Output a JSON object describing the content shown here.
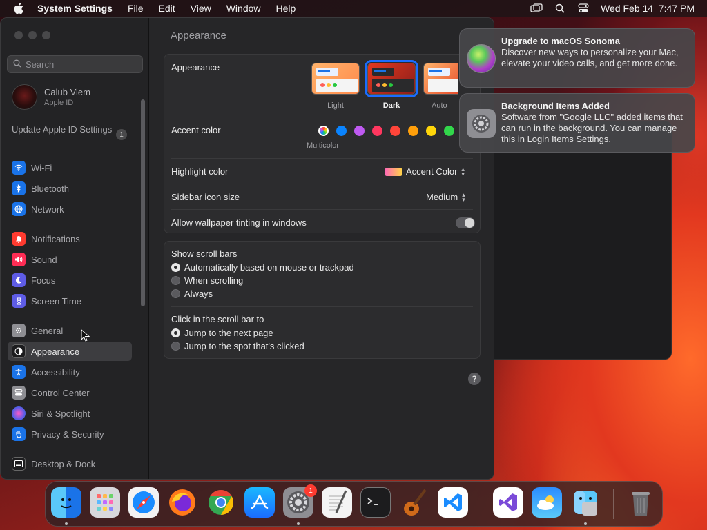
{
  "menubar": {
    "app_name": "System Settings",
    "items": [
      "File",
      "Edit",
      "View",
      "Window",
      "Help"
    ],
    "clock": "Wed Feb 14  7:47 PM"
  },
  "sidebar": {
    "search_placeholder": "Search",
    "profile": {
      "name": "Calub Viem",
      "subtitle": "Apple ID"
    },
    "update": {
      "label": "Update Apple ID Settings",
      "badge": "1"
    },
    "items": [
      {
        "label": "Wi-Fi",
        "icon": "wifi-icon",
        "color": "#1a73e8"
      },
      {
        "label": "Bluetooth",
        "icon": "bluetooth-icon",
        "color": "#1a73e8"
      },
      {
        "label": "Network",
        "icon": "globe-icon",
        "color": "#1a73e8"
      },
      {
        "label": "Notifications",
        "icon": "bell-icon",
        "color": "#ff3b30"
      },
      {
        "label": "Sound",
        "icon": "speaker-icon",
        "color": "#ff2d55"
      },
      {
        "label": "Focus",
        "icon": "moon-icon",
        "color": "#5e5ce6"
      },
      {
        "label": "Screen Time",
        "icon": "hourglass-icon",
        "color": "#5e5ce6"
      },
      {
        "label": "General",
        "icon": "gear-icon",
        "color": "#8e8e93"
      },
      {
        "label": "Appearance",
        "icon": "appearance-icon",
        "color": "#1c1c1e"
      },
      {
        "label": "Accessibility",
        "icon": "accessibility-icon",
        "color": "#1a73e8"
      },
      {
        "label": "Control Center",
        "icon": "control-center-icon",
        "color": "#8e8e93"
      },
      {
        "label": "Siri & Spotlight",
        "icon": "siri-icon",
        "color": "#bf5af2"
      },
      {
        "label": "Privacy & Security",
        "icon": "hand-icon",
        "color": "#1a73e8"
      },
      {
        "label": "Desktop & Dock",
        "icon": "dock-icon",
        "color": "#1c1c1e"
      }
    ],
    "selected": "Appearance"
  },
  "main": {
    "title": "Appearance",
    "appearance": {
      "label": "Appearance",
      "options": [
        "Light",
        "Dark",
        "Auto"
      ],
      "selected": "Dark"
    },
    "accent": {
      "label": "Accent color",
      "multicolor_label": "Multicolor",
      "colors": [
        "#ffffff",
        "#0a84ff",
        "#bf5af2",
        "#ff375f",
        "#ff453a",
        "#ff9f0a",
        "#ffd60a",
        "#32d74b"
      ]
    },
    "highlight": {
      "label": "Highlight color",
      "value": "Accent Color"
    },
    "sidebar_icon_size": {
      "label": "Sidebar icon size",
      "value": "Medium"
    },
    "wallpaper_tinting": {
      "label": "Allow wallpaper tinting in windows",
      "enabled": true
    },
    "scroll_bars": {
      "label": "Show scroll bars",
      "options": [
        "Automatically based on mouse or trackpad",
        "When scrolling",
        "Always"
      ],
      "selected": "Automatically based on mouse or trackpad"
    },
    "click_scroll": {
      "label": "Click in the scroll bar to",
      "options": [
        "Jump to the next page",
        "Jump to the spot that's clicked"
      ],
      "selected": "Jump to the next page"
    },
    "help": "?"
  },
  "notifications": [
    {
      "title": "Upgrade to macOS Sonoma",
      "body": "Discover new ways to personalize your Mac, elevate your video calls, and get more done."
    },
    {
      "title": "Background Items Added",
      "body": "Software from \"Google LLC\" added items that can run in the background. You can manage this in Login Items Settings."
    }
  ],
  "dock": {
    "apps": [
      "finder",
      "launchpad",
      "safari",
      "firefox",
      "chrome",
      "app-store",
      "system-settings",
      "textedit",
      "terminal",
      "garageband",
      "vscode",
      "visual-studio",
      "weather",
      "preview",
      "trash"
    ],
    "settings_badge": "1"
  }
}
